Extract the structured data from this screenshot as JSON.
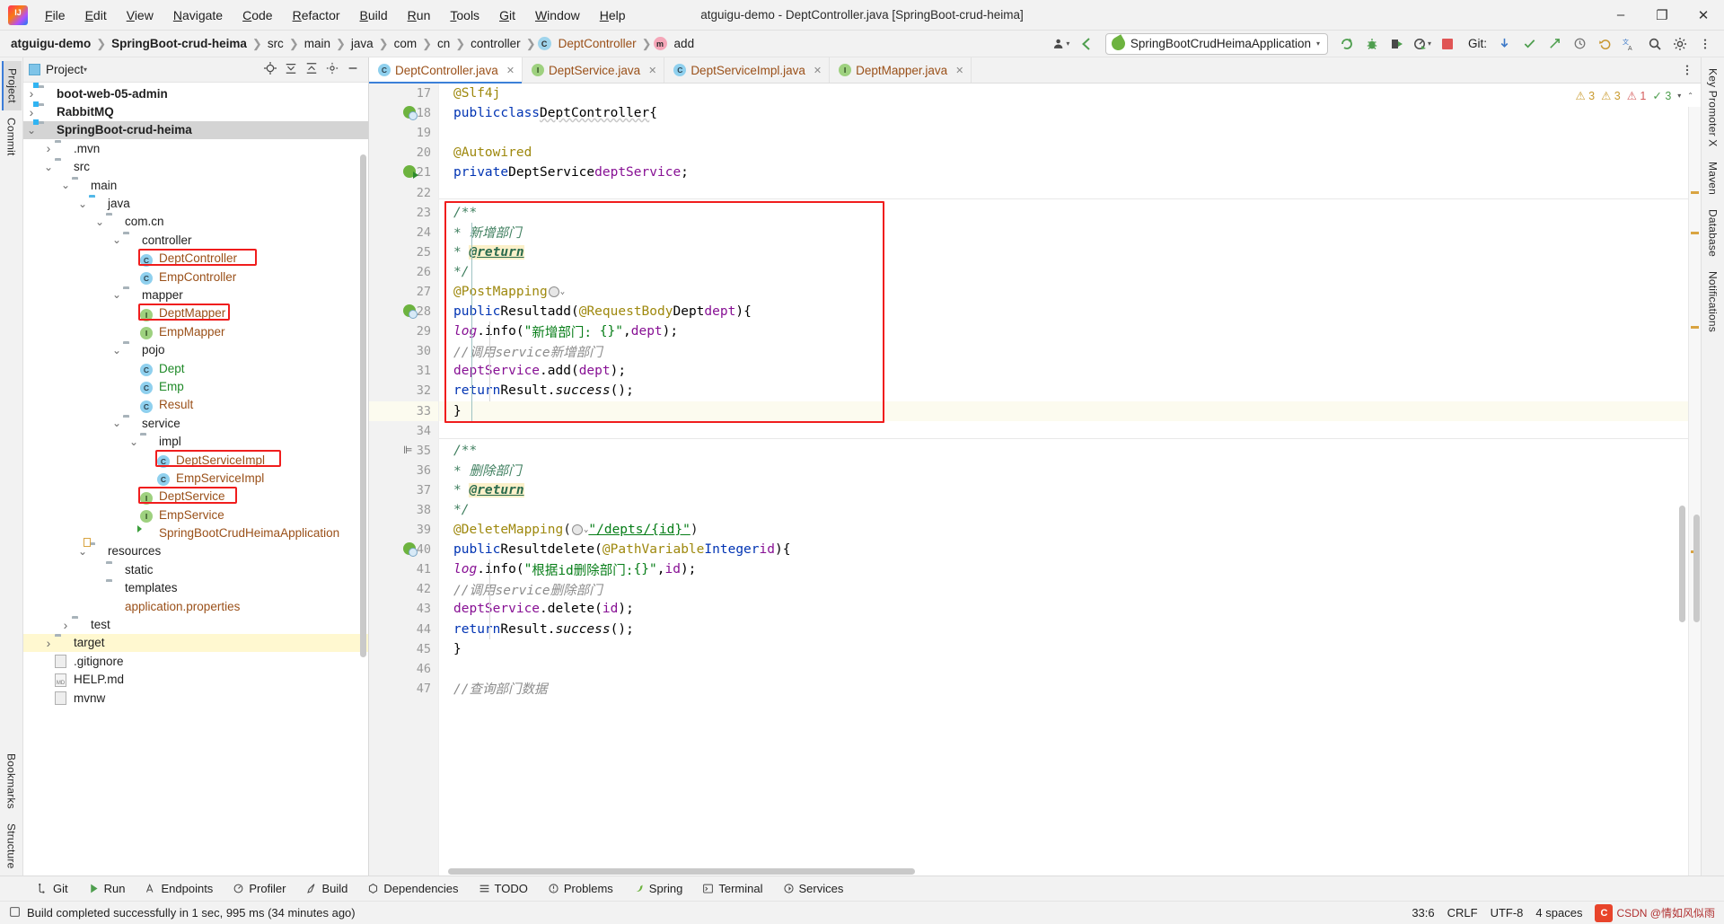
{
  "window": {
    "title": "atguigu-demo - DeptController.java [SpringBoot-crud-heima]",
    "minimize": "–",
    "maximize": "❐",
    "close": "✕"
  },
  "menu": [
    "File",
    "Edit",
    "View",
    "Navigate",
    "Code",
    "Refactor",
    "Build",
    "Run",
    "Tools",
    "Git",
    "Window",
    "Help"
  ],
  "breadcrumb": [
    {
      "label": "atguigu-demo",
      "style": "bold"
    },
    {
      "label": "SpringBoot-crud-heima",
      "style": "bold"
    },
    {
      "label": "src",
      "style": "plain"
    },
    {
      "label": "main",
      "style": "plain"
    },
    {
      "label": "java",
      "style": "plain"
    },
    {
      "label": "com",
      "style": "plain"
    },
    {
      "label": "cn",
      "style": "plain"
    },
    {
      "label": "controller",
      "style": "plain"
    },
    {
      "label": "DeptController",
      "style": "class",
      "icon": "C"
    },
    {
      "label": "add",
      "style": "method",
      "icon": "m"
    }
  ],
  "toolbar": {
    "run_config": "SpringBootCrudHeimaApplication",
    "git_label": "Git:",
    "icons": [
      "profile-icon",
      "back-arrow-icon",
      "rerun-icon",
      "debug-icon",
      "coverage-icon",
      "profiler-icon",
      "stop-icon",
      "git-update-icon",
      "git-commit-icon",
      "git-push-icon",
      "git-history-icon",
      "git-rollback-icon",
      "translate-icon",
      "search-icon",
      "settings-icon",
      "account-icon"
    ]
  },
  "left_strip": {
    "tabs": [
      {
        "label": "Project",
        "selected": true
      },
      {
        "label": "Commit",
        "selected": false
      }
    ],
    "bottom": [
      {
        "label": "Bookmarks"
      },
      {
        "label": "Structure"
      }
    ]
  },
  "right_strip": {
    "tabs": [
      "Key Promoter X",
      "Maven",
      "Database",
      "Notifications"
    ]
  },
  "project_pane": {
    "title": "Project",
    "actions": [
      "target-icon",
      "collapse-all-icon",
      "expand-all-icon",
      "settings-icon",
      "hide-icon"
    ],
    "tree": [
      {
        "indent": 1,
        "arrow": "▶",
        "icon": "module",
        "label": "boot-web-05-admin",
        "style": "bold"
      },
      {
        "indent": 1,
        "arrow": "▶",
        "icon": "module",
        "label": "RabbitMQ",
        "style": "bold"
      },
      {
        "indent": 1,
        "arrow": "▼",
        "icon": "module",
        "label": "SpringBoot-crud-heima",
        "style": "bold",
        "selected": true
      },
      {
        "indent": 2,
        "arrow": "▶",
        "icon": "folder",
        "label": ".mvn",
        "style": "plain"
      },
      {
        "indent": 2,
        "arrow": "▼",
        "icon": "folder",
        "label": "src",
        "style": "plain"
      },
      {
        "indent": 3,
        "arrow": "▼",
        "icon": "folder",
        "label": "main",
        "style": "plain"
      },
      {
        "indent": 4,
        "arrow": "▼",
        "icon": "src-folder",
        "label": "java",
        "style": "plain"
      },
      {
        "indent": 5,
        "arrow": "▼",
        "icon": "package",
        "label": "com.cn",
        "style": "plain"
      },
      {
        "indent": 6,
        "arrow": "▼",
        "icon": "package",
        "label": "controller",
        "style": "plain"
      },
      {
        "indent": 7,
        "arrow": "",
        "icon": "class",
        "label": "DeptController",
        "style": "class",
        "highlight": true
      },
      {
        "indent": 7,
        "arrow": "",
        "icon": "class",
        "label": "EmpController",
        "style": "class"
      },
      {
        "indent": 6,
        "arrow": "▼",
        "icon": "package",
        "label": "mapper",
        "style": "plain"
      },
      {
        "indent": 7,
        "arrow": "",
        "icon": "interface",
        "label": "DeptMapper",
        "style": "class",
        "highlight": true
      },
      {
        "indent": 7,
        "arrow": "",
        "icon": "interface",
        "label": "EmpMapper",
        "style": "class"
      },
      {
        "indent": 6,
        "arrow": "▼",
        "icon": "package",
        "label": "pojo",
        "style": "plain"
      },
      {
        "indent": 7,
        "arrow": "",
        "icon": "class",
        "label": "Dept",
        "style": "green"
      },
      {
        "indent": 7,
        "arrow": "",
        "icon": "class",
        "label": "Emp",
        "style": "green"
      },
      {
        "indent": 7,
        "arrow": "",
        "icon": "class",
        "label": "Result",
        "style": "class"
      },
      {
        "indent": 6,
        "arrow": "▼",
        "icon": "package",
        "label": "service",
        "style": "plain"
      },
      {
        "indent": 7,
        "arrow": "▼",
        "icon": "package",
        "label": "impl",
        "style": "plain"
      },
      {
        "indent": 8,
        "arrow": "",
        "icon": "class",
        "label": "DeptServiceImpl",
        "style": "class",
        "highlight": true
      },
      {
        "indent": 8,
        "arrow": "",
        "icon": "class",
        "label": "EmpServiceImpl",
        "style": "class"
      },
      {
        "indent": 7,
        "arrow": "",
        "icon": "interface",
        "label": "DeptService",
        "style": "class",
        "highlight": true
      },
      {
        "indent": 7,
        "arrow": "",
        "icon": "interface",
        "label": "EmpService",
        "style": "class"
      },
      {
        "indent": 7,
        "arrow": "",
        "icon": "spring",
        "label": "SpringBootCrudHeimaApplication",
        "style": "class"
      },
      {
        "indent": 4,
        "arrow": "▼",
        "icon": "resources",
        "label": "resources",
        "style": "plain"
      },
      {
        "indent": 5,
        "arrow": "",
        "icon": "folder",
        "label": "static",
        "style": "plain"
      },
      {
        "indent": 5,
        "arrow": "",
        "icon": "folder",
        "label": "templates",
        "style": "plain"
      },
      {
        "indent": 5,
        "arrow": "",
        "icon": "properties",
        "label": "application.properties",
        "style": "class"
      },
      {
        "indent": 3,
        "arrow": "▶",
        "icon": "folder",
        "label": "test",
        "style": "plain"
      },
      {
        "indent": 2,
        "arrow": "▶",
        "icon": "folder",
        "label": "target",
        "style": "plain",
        "target": true
      },
      {
        "indent": 2,
        "arrow": "",
        "icon": "file",
        "label": ".gitignore",
        "style": "plain"
      },
      {
        "indent": 2,
        "arrow": "",
        "icon": "md",
        "label": "HELP.md",
        "style": "plain"
      },
      {
        "indent": 2,
        "arrow": "",
        "icon": "file",
        "label": "mvnw",
        "style": "plain"
      }
    ]
  },
  "editor": {
    "tabs": [
      {
        "label": "DeptController.java",
        "icon": "class",
        "active": true
      },
      {
        "label": "DeptService.java",
        "icon": "interface",
        "active": false
      },
      {
        "label": "DeptServiceImpl.java",
        "icon": "class",
        "active": false
      },
      {
        "label": "DeptMapper.java",
        "icon": "interface",
        "active": false
      }
    ],
    "inspections": {
      "warnings": "3",
      "warnings2": "3",
      "errors": "1",
      "greens": "3"
    },
    "first_line_number": 17,
    "current_line": 33,
    "lines": [
      {
        "n": 17,
        "marker": "",
        "fold": "▽",
        "text": "@Slf4j"
      },
      {
        "n": 18,
        "marker": "globe",
        "fold": "",
        "text": "public class DeptController {"
      },
      {
        "n": 19,
        "marker": "",
        "fold": "",
        "text": ""
      },
      {
        "n": 20,
        "marker": "",
        "fold": "",
        "text": "    @Autowired"
      },
      {
        "n": 21,
        "marker": "run",
        "fold": "",
        "text": "    private DeptService deptService;"
      },
      {
        "n": 22,
        "marker": "",
        "fold": "",
        "text": ""
      },
      {
        "n": 23,
        "marker": "",
        "fold": "▽",
        "text": "    /**"
      },
      {
        "n": 24,
        "marker": "",
        "fold": "",
        "text": "     * 新增部门"
      },
      {
        "n": 25,
        "marker": "",
        "fold": "",
        "text": "     * @return"
      },
      {
        "n": 26,
        "marker": "",
        "fold": "△",
        "text": "     */"
      },
      {
        "n": 27,
        "marker": "",
        "fold": "",
        "text": "    @PostMapping"
      },
      {
        "n": 28,
        "marker": "globe",
        "fold": "▽",
        "text": "    public Result add(@RequestBody Dept dept){"
      },
      {
        "n": 29,
        "marker": "",
        "fold": "",
        "text": "        log.info(\"新增部门: {}\" , dept);"
      },
      {
        "n": 30,
        "marker": "",
        "fold": "",
        "text": "        //调用service新增部门"
      },
      {
        "n": 31,
        "marker": "",
        "fold": "",
        "text": "        deptService.add(dept);"
      },
      {
        "n": 32,
        "marker": "",
        "fold": "",
        "text": "        return Result.success();"
      },
      {
        "n": 33,
        "marker": "",
        "fold": "△",
        "text": "    }"
      },
      {
        "n": 34,
        "marker": "",
        "fold": "",
        "text": ""
      },
      {
        "n": 35,
        "marker": "format",
        "fold": "▽",
        "text": "    /**"
      },
      {
        "n": 36,
        "marker": "",
        "fold": "",
        "text": "     * 删除部门"
      },
      {
        "n": 37,
        "marker": "",
        "fold": "",
        "text": "     * @return"
      },
      {
        "n": 38,
        "marker": "",
        "fold": "△",
        "text": "     */"
      },
      {
        "n": 39,
        "marker": "",
        "fold": "",
        "text": "    @DeleteMapping(\"/depts/{id}\")"
      },
      {
        "n": 40,
        "marker": "globe",
        "fold": "▽",
        "text": "    public Result delete(@PathVariable Integer id){"
      },
      {
        "n": 41,
        "marker": "",
        "fold": "",
        "text": "        log.info(\"根据id删除部门:{}\",id);"
      },
      {
        "n": 42,
        "marker": "",
        "fold": "",
        "text": "        //调用service删除部门"
      },
      {
        "n": 43,
        "marker": "",
        "fold": "",
        "text": "        deptService.delete(id);"
      },
      {
        "n": 44,
        "marker": "",
        "fold": "",
        "text": "        return Result.success();"
      },
      {
        "n": 45,
        "marker": "",
        "fold": "",
        "text": "    }"
      },
      {
        "n": 46,
        "marker": "",
        "fold": "",
        "text": ""
      },
      {
        "n": 47,
        "marker": "",
        "fold": "",
        "text": "    //查询部门数据"
      }
    ]
  },
  "bottom_tools": [
    {
      "label": "Git",
      "icon": "git-icon"
    },
    {
      "label": "Run",
      "icon": "run-icon"
    },
    {
      "label": "Endpoints",
      "icon": "endpoints-icon"
    },
    {
      "label": "Profiler",
      "icon": "profiler-icon"
    },
    {
      "label": "Build",
      "icon": "build-icon"
    },
    {
      "label": "Dependencies",
      "icon": "dependencies-icon"
    },
    {
      "label": "TODO",
      "icon": "todo-icon"
    },
    {
      "label": "Problems",
      "icon": "problems-icon"
    },
    {
      "label": "Spring",
      "icon": "spring-icon"
    },
    {
      "label": "Terminal",
      "icon": "terminal-icon"
    },
    {
      "label": "Services",
      "icon": "services-icon"
    }
  ],
  "statusbar": {
    "message": "Build completed successfully in 1 sec, 995 ms (34 minutes ago)",
    "caret": "33:6",
    "line_sep": "CRLF",
    "encoding": "UTF-8",
    "indent": "4 spaces",
    "watermark": "CSDN @情如风似雨"
  },
  "colors": {
    "accent": "#3c80d8",
    "highlight_red": "#f01d1d",
    "spring_green": "#6db33f",
    "keyword_blue": "#0033b3",
    "string_green": "#067d17",
    "annotation_gold": "#9e880d",
    "field_purple": "#871094",
    "class_orange": "#9a5019"
  }
}
